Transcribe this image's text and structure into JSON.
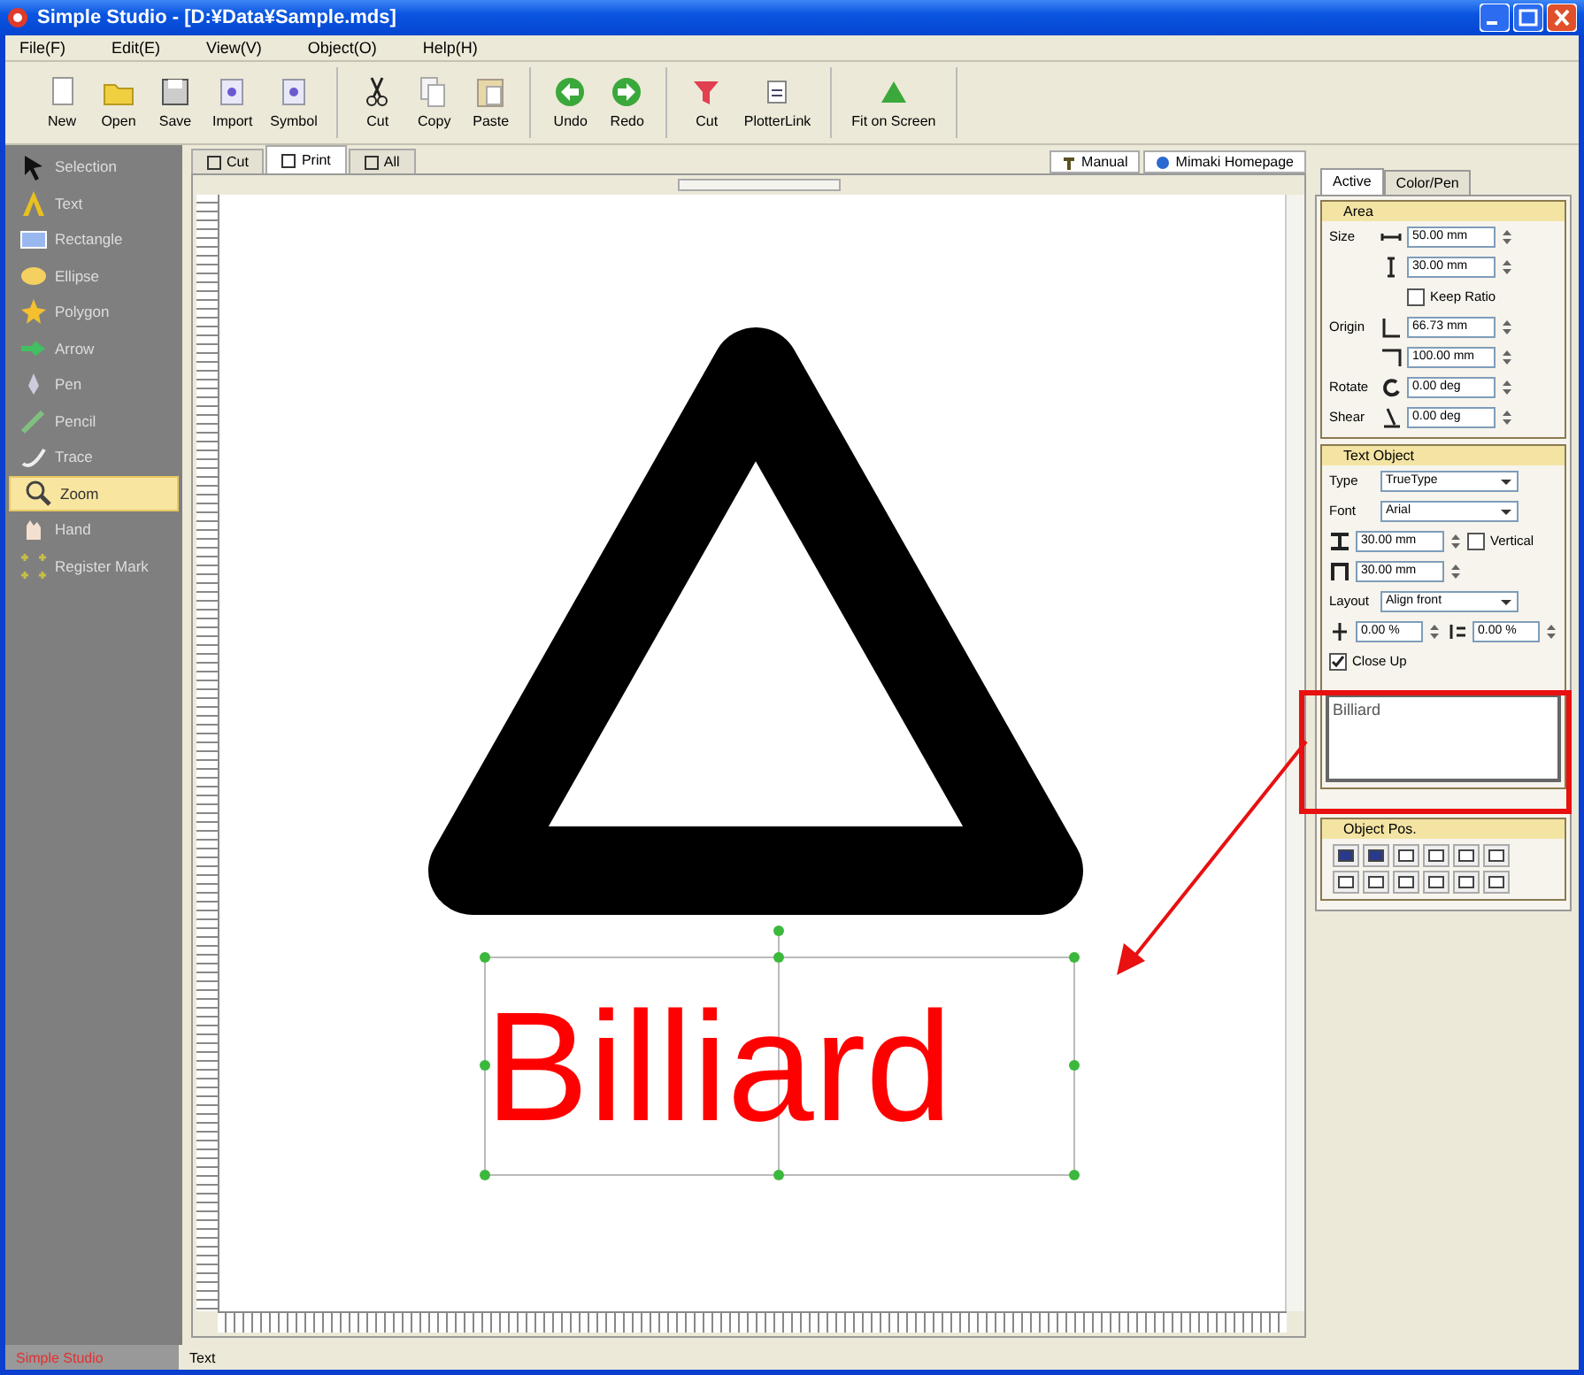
{
  "window": {
    "title": "Simple Studio - [D:¥Data¥Sample.mds]"
  },
  "menu": [
    "File(F)",
    "Edit(E)",
    "View(V)",
    "Object(O)",
    "Help(H)"
  ],
  "toolbar": [
    {
      "buttons": [
        {
          "label": "New"
        },
        {
          "label": "Open"
        },
        {
          "label": "Save"
        },
        {
          "label": "Import"
        },
        {
          "label": "Symbol"
        }
      ]
    },
    {
      "buttons": [
        {
          "label": "Cut"
        },
        {
          "label": "Copy"
        },
        {
          "label": "Paste"
        }
      ]
    },
    {
      "buttons": [
        {
          "label": "Undo"
        },
        {
          "label": "Redo"
        }
      ]
    },
    {
      "buttons": [
        {
          "label": "Cut"
        },
        {
          "label": "PlotterLink"
        }
      ]
    },
    {
      "buttons": [
        {
          "label": "Fit on Screen"
        }
      ]
    }
  ],
  "tools": [
    {
      "label": "Selection",
      "selected": false
    },
    {
      "label": "Text",
      "selected": false
    },
    {
      "label": "Rectangle",
      "selected": false
    },
    {
      "label": "Ellipse",
      "selected": false
    },
    {
      "label": "Polygon",
      "selected": false
    },
    {
      "label": "Arrow",
      "selected": false
    },
    {
      "label": "Pen",
      "selected": false
    },
    {
      "label": "Pencil",
      "selected": false
    },
    {
      "label": "Trace",
      "selected": false
    },
    {
      "label": "Zoom",
      "selected": true
    },
    {
      "label": "Hand",
      "selected": false
    },
    {
      "label": "Register Mark",
      "selected": false
    }
  ],
  "document_tabs": [
    {
      "label": "Cut",
      "selected": false
    },
    {
      "label": "Print",
      "selected": true
    },
    {
      "label": "All",
      "selected": false
    }
  ],
  "links": [
    "Manual",
    "Mimaki Homepage"
  ],
  "canvas": {
    "text": "Billiard",
    "selected": true
  },
  "panel": {
    "tabs": [
      {
        "label": "Active",
        "selected": true
      },
      {
        "label": "Color/Pen",
        "selected": false
      }
    ],
    "area": {
      "title": "Area",
      "size_label": "Size",
      "width": "50.00 mm",
      "height": "30.00 mm",
      "keep_ratio": {
        "label": "Keep Ratio",
        "checked": false
      },
      "origin_label": "Origin",
      "x": "66.73 mm",
      "y": "100.00 mm",
      "rotate_label": "Rotate",
      "rotate": "0.00 deg",
      "shear_label": "Shear",
      "shear": "0.00 deg"
    },
    "text_object": {
      "title": "Text Object",
      "type_label": "Type",
      "type": "TrueType",
      "font_label": "Font",
      "font": "Arial",
      "char_width": "30.00 mm",
      "vertical": {
        "label": "Vertical",
        "checked": false
      },
      "char_height": "30.00 mm",
      "layout_label": "Layout",
      "layout": "Align front",
      "spacing_1": "0.00 %",
      "spacing_2": "0.00 %",
      "close_up": {
        "label": "Close Up",
        "checked": true
      },
      "content": "Billiard"
    },
    "object_pos": {
      "title": "Object Pos."
    }
  },
  "status_bar": [
    {
      "label": "Simple Studio",
      "selected": true
    },
    {
      "label": "Text",
      "selected": false
    }
  ]
}
